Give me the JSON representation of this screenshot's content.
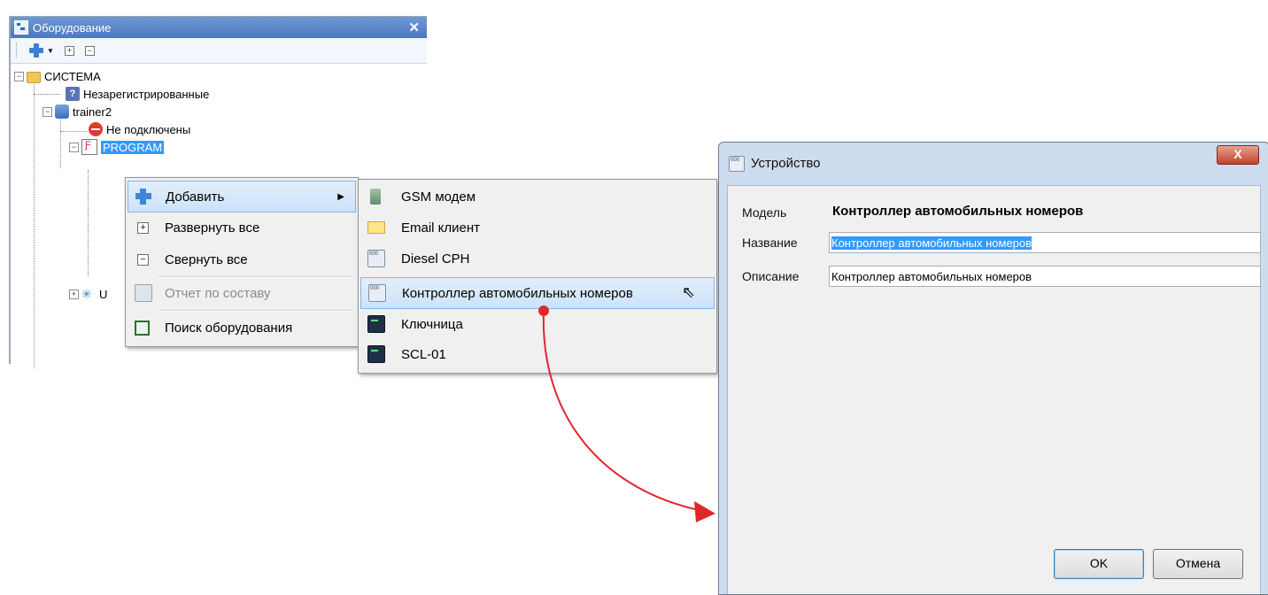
{
  "panel": {
    "title": "Оборудование",
    "close_glyph": "✕",
    "toolbar": {
      "add_icon": "plus-icon",
      "expand_glyph": "+",
      "collapse_glyph": "−"
    }
  },
  "tree": {
    "system": "СИСТЕМА",
    "unregistered": "Незарегистрированные",
    "trainer": "trainer2",
    "not_connected": "Не подключены",
    "program": "PROGRAM",
    "partial_item": "U"
  },
  "context_menu": {
    "items": [
      {
        "label": "Добавить",
        "icon": "plus-icon",
        "submenu": true,
        "highlighted": true
      },
      {
        "label": "Развернуть все",
        "icon": "expand-box-icon"
      },
      {
        "label": "Свернуть все",
        "icon": "collapse-box-icon"
      },
      {
        "label": "Отчет по составу",
        "icon": "report-icon",
        "disabled": true
      },
      {
        "label": "Поиск оборудования",
        "icon": "search-device-icon"
      }
    ]
  },
  "submenu": {
    "items": [
      {
        "label": "GSM модем",
        "icon": "gsm-modem-icon"
      },
      {
        "label": "Email клиент",
        "icon": "email-icon"
      },
      {
        "label": "Diesel CPH",
        "icon": "device-icon"
      },
      {
        "label": "Контроллер автомобильных номеров",
        "icon": "device-icon",
        "highlighted": true
      },
      {
        "label": "Ключница",
        "icon": "terminal-icon"
      },
      {
        "label": "SCL-01",
        "icon": "terminal-icon"
      }
    ]
  },
  "dialog": {
    "title": "Устройство",
    "close_glyph": "X",
    "model_label": "Модель",
    "model_value": "Контроллер автомобильных номеров",
    "name_label": "Название",
    "name_value": "Контроллер автомобильных номеров",
    "description_label": "Описание",
    "description_value": "Контроллер автомобильных номеров",
    "ok_label": "OK",
    "cancel_label": "Отмена"
  },
  "colors": {
    "accent_selection": "#3399ff",
    "title_bar": "#4c79c0",
    "arrow": "#e0262c"
  }
}
